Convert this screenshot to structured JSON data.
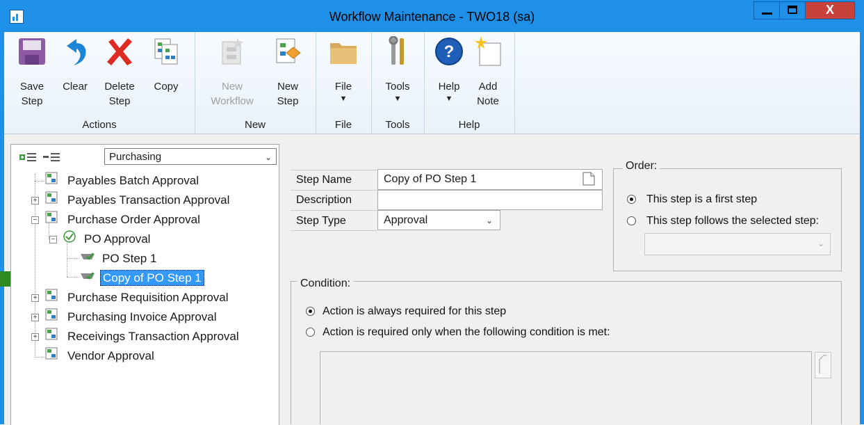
{
  "window": {
    "title": "Workflow Maintenance  -  TWO18 (sa)",
    "close_glyph": "X"
  },
  "ribbon": {
    "groups": {
      "actions": "Actions",
      "new": "New",
      "file": "File",
      "tools": "Tools",
      "help": "Help"
    },
    "buttons": {
      "save_step": "Save\nStep",
      "clear": "Clear",
      "delete_step": "Delete\nStep",
      "copy": "Copy",
      "new_workflow": "New\nWorkflow",
      "new_step": "New\nStep",
      "file": "File",
      "tools": "Tools",
      "help": "Help",
      "add_note": "Add\nNote"
    },
    "caret": "▼"
  },
  "tree": {
    "module_select": "Purchasing",
    "items": {
      "payables_batch": "Payables Batch Approval",
      "payables_transaction": "Payables Transaction Approval",
      "purchase_order": "Purchase Order Approval",
      "po_approval": "PO Approval",
      "po_step_1": "PO Step 1",
      "copy_po_step_1": "Copy of PO Step 1",
      "purchase_requisition": "Purchase Requisition Approval",
      "purchasing_invoice": "Purchasing Invoice Approval",
      "receivings_transaction": "Receivings Transaction Approval",
      "vendor_approval": "Vendor Approval"
    }
  },
  "form": {
    "step_name_label": "Step Name",
    "step_name_value": "Copy of PO Step 1",
    "description_label": "Description",
    "description_value": "",
    "step_type_label": "Step Type",
    "step_type_value": "Approval"
  },
  "order": {
    "title": "Order:",
    "first_step": "This step is a first step",
    "follows_step": "This step follows the selected step:",
    "selected": "first_step"
  },
  "condition": {
    "title": "Condition:",
    "always_required": "Action is always required for this step",
    "required_when": "Action is required only when the following condition is met:",
    "selected": "always_required"
  },
  "colors": {
    "titlebar": "#1e90e8",
    "selection": "#3399ff",
    "arrow": "#2e8b22"
  }
}
